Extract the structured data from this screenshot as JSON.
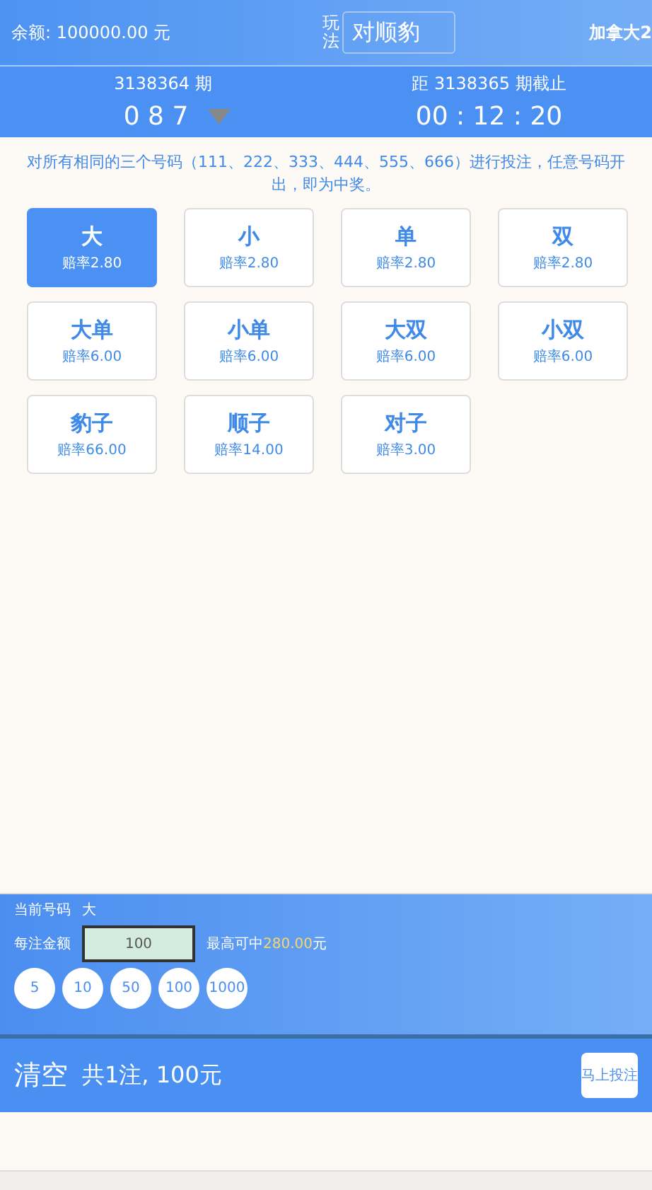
{
  "header": {
    "balance": "余额: 100000.00 元",
    "play_label": "玩法",
    "play_value": "对顺豹",
    "lottery": "加拿大2"
  },
  "issue": {
    "current": "3138364 期",
    "result": "0 8 7",
    "next": "距 3138365 期截止",
    "countdown": "00 : 12 : 20"
  },
  "description": "对所有相同的三个号码（111、222、333、444、555、666）进行投注，任意号码开出，即为中奖。",
  "options": [
    {
      "name": "大",
      "odds": "赔率2.80",
      "selected": true
    },
    {
      "name": "小",
      "odds": "赔率2.80",
      "selected": false
    },
    {
      "name": "单",
      "odds": "赔率2.80",
      "selected": false
    },
    {
      "name": "双",
      "odds": "赔率2.80",
      "selected": false
    },
    {
      "name": "大单",
      "odds": "赔率6.00",
      "selected": false
    },
    {
      "name": "小单",
      "odds": "赔率6.00",
      "selected": false
    },
    {
      "name": "大双",
      "odds": "赔率6.00",
      "selected": false
    },
    {
      "name": "小双",
      "odds": "赔率6.00",
      "selected": false
    },
    {
      "name": "豹子",
      "odds": "赔率66.00",
      "selected": false
    },
    {
      "name": "顺子",
      "odds": "赔率14.00",
      "selected": false
    },
    {
      "name": "对子",
      "odds": "赔率3.00",
      "selected": false
    }
  ],
  "bet_panel": {
    "current_label": "当前号码",
    "current_value": "大",
    "amount_label": "每注金额",
    "amount_value": "100",
    "max_win_prefix": "最高可中",
    "max_win_value": "280.00",
    "max_win_suffix": "元",
    "chips": [
      "5",
      "10",
      "50",
      "100",
      "1000"
    ]
  },
  "footer": {
    "clear": "清空",
    "summary": "共1注, 100元",
    "submit": "马上投注"
  }
}
